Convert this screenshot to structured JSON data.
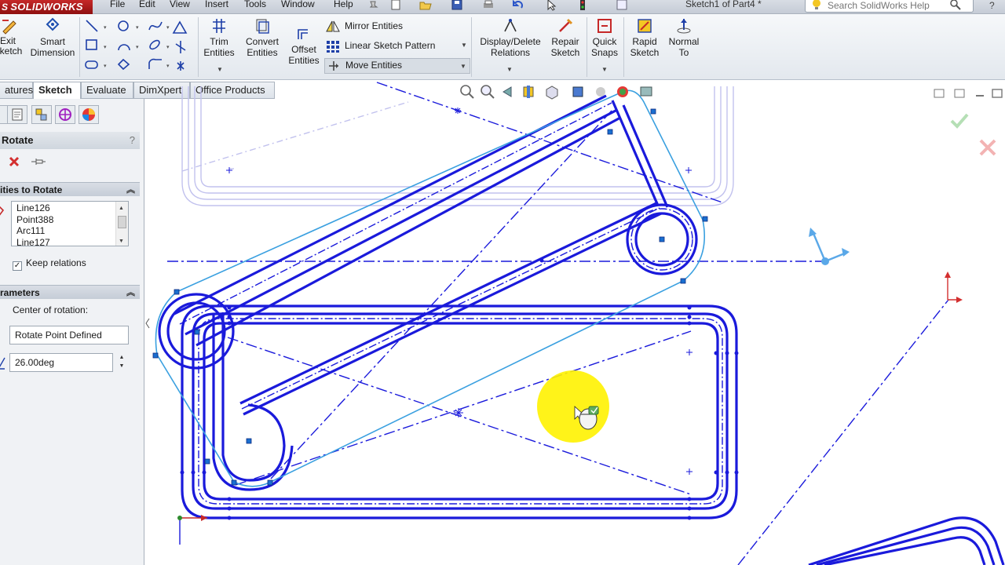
{
  "app": {
    "logo_text": "SOLIDWORKS",
    "logo_prefix": "S",
    "document_title": "Sketch1 of Part4 *",
    "search_placeholder": "Search SolidWorks Help"
  },
  "menu": [
    "File",
    "Edit",
    "View",
    "Insert",
    "Tools",
    "Window",
    "Help"
  ],
  "ribbon": {
    "exit_sketch": "Exit Sketch",
    "smart_dimension": "Smart Dimension",
    "trim_entities": "Trim Entities",
    "convert_entities": "Convert Entities",
    "offset_entities": "Offset Entities",
    "mirror_entities": "Mirror Entities",
    "linear_sketch_pattern": "Linear Sketch Pattern",
    "move_entities": "Move Entities",
    "display_delete_relations": "Display/Delete Relations",
    "repair_sketch": "Repair Sketch",
    "quick_snaps": "Quick Snaps",
    "rapid_sketch": "Rapid Sketch",
    "normal_to": "Normal To"
  },
  "tabs": [
    {
      "label": "Features",
      "visible_label": "atures",
      "active": false
    },
    {
      "label": "Sketch",
      "visible_label": "Sketch",
      "active": true
    },
    {
      "label": "Evaluate",
      "visible_label": "Evaluate",
      "active": false
    },
    {
      "label": "DimXpert",
      "visible_label": "DimXpert",
      "active": false
    },
    {
      "label": "Office Products",
      "visible_label": "Office Products",
      "active": false
    }
  ],
  "property_manager": {
    "title": "Rotate",
    "help": "?",
    "entities_section": "ities to Rotate",
    "entities": [
      "Line126",
      "Point388",
      "Arc111",
      "Line127"
    ],
    "keep_relations_label": "Keep relations",
    "keep_relations_checked": true,
    "parameters_section": "rameters",
    "center_label": "Center of rotation:",
    "center_value": "Rotate Point Defined",
    "angle_value": "26.00deg"
  },
  "colors": {
    "sketch_blue": "#1a1adb",
    "selected_blue": "#3aa0e0",
    "faded_sketch": "#b4b4ea",
    "logo_red": "#b71c1c",
    "highlight_yellow": "#fff200"
  },
  "icons": {
    "ok": "green-check-icon",
    "cancel": "red-x-icon"
  }
}
